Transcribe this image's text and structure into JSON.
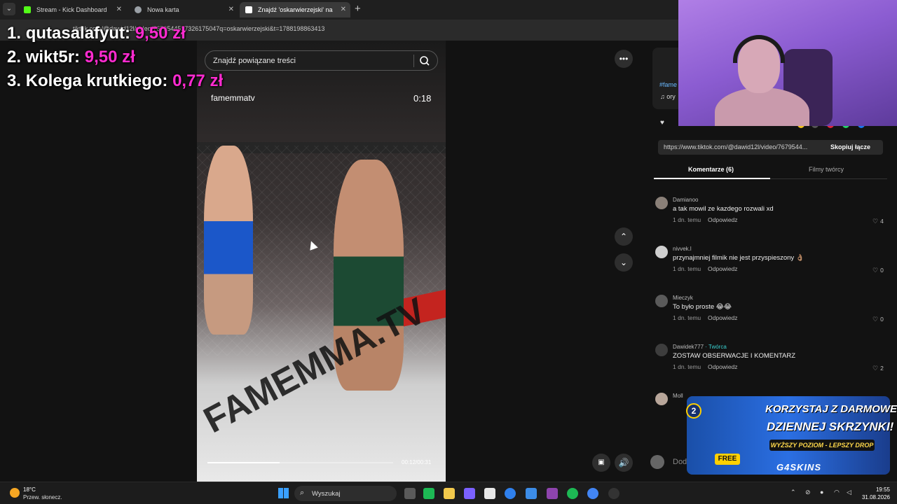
{
  "browser": {
    "tabs": [
      {
        "label": "Stream - Kick Dashboard",
        "favicon_color": "#53fc18"
      },
      {
        "label": "Nowa karta",
        "favicon_color": "#9aa0a6"
      },
      {
        "label": "Znajdź 'oskarwierzejski' na",
        "favicon_color": "#ffffff"
      }
    ],
    "url": "tiktok.com/@dawid12l/video/7679544517326175047q=oskarwierzejski&t=1788198863413"
  },
  "video": {
    "search_placeholder": "Znajdź powiązane treści",
    "author": "famemmatv",
    "duration": "0:18",
    "timecode": "00:12/00:31",
    "progress": 0.39,
    "floor_text": "FAMEMMA.TV"
  },
  "right_panel": {
    "hashtag": "#fame",
    "music": "♫ ory",
    "link_url": "https://www.tiktok.com/@dawid12l/video/7679544...",
    "copy_label": "Skopiuj łącze",
    "tabs": [
      "Komentarze (6)",
      "Filmy twórcy"
    ],
    "comments": [
      {
        "user": "Damianoo",
        "creator": "",
        "text": "a tak mowil ze kazdego rozwali xd",
        "date": "1 dn. temu",
        "reply": "Odpowiedz",
        "likes": "4"
      },
      {
        "user": "nivvek.l",
        "creator": "",
        "text": "przynajmniej filmik nie jest przyspieszony 👌🏽",
        "date": "1 dn. temu",
        "reply": "Odpowiedz",
        "likes": "0"
      },
      {
        "user": "Mieczyk",
        "creator": "",
        "text": "To było proste 😂😂",
        "date": "1 dn. temu",
        "reply": "Odpowiedz",
        "likes": "0"
      },
      {
        "user": "Dawidek777",
        "creator": " · Twórca",
        "text": "ZOSTAW OBSERWACJE I KOMENTARZ",
        "date": "1 dn. temu",
        "reply": "Odpowiedz",
        "likes": "2"
      },
      {
        "user": "Moll",
        "creator": "",
        "text": "",
        "date": "",
        "reply": "",
        "likes": ""
      }
    ],
    "comment_placeholder": "Dod"
  },
  "leaderboard": [
    {
      "rank": "1.",
      "name": "qutasalafyut:",
      "amount": "9,50 zł"
    },
    {
      "rank": "2.",
      "name": "wikt5r:",
      "amount": "9,50 zł"
    },
    {
      "rank": "3.",
      "name": "Kolega krutkiego:",
      "amount": "0,77 zł"
    }
  ],
  "promo": {
    "line1": "KORZYSTAJ Z DARMOWEJ",
    "line2": "DZIENNEJ SKRZYNKI!",
    "sub": "WYŻSZY POZIOM - LEPSZY DROP",
    "free": "FREE",
    "brand": "G4SKINS",
    "level": "2"
  },
  "taskbar": {
    "temp": "18°C",
    "weather": "Przew. słonecz.",
    "search": "Wyszukaj",
    "time": "19:55",
    "date": "31.08.2026"
  },
  "colors": {
    "accent_pink": "#ff2bd0",
    "link_blue": "#69b8ff",
    "creator_teal": "#39d0d0"
  }
}
